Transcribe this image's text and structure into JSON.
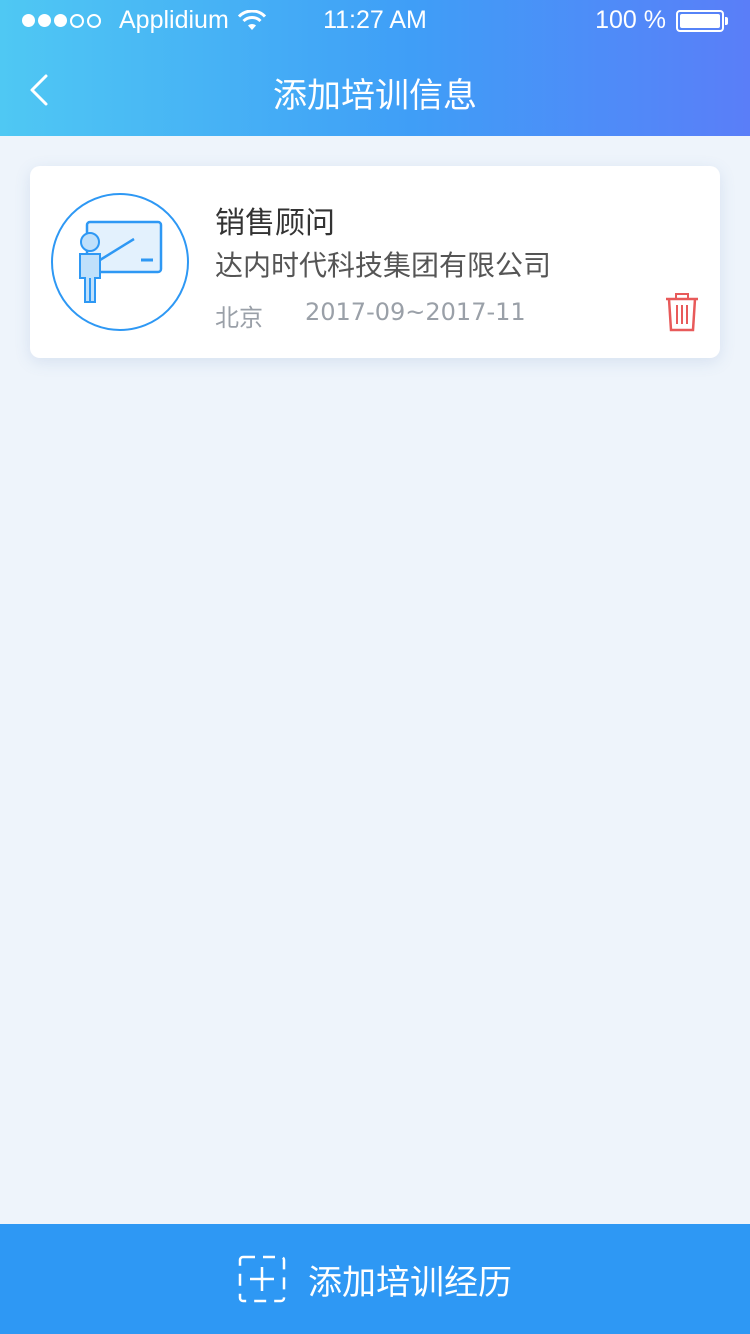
{
  "status_bar": {
    "carrier": "Applidium",
    "time": "11:27 AM",
    "battery": "100 %"
  },
  "header": {
    "title": "添加培训信息"
  },
  "training_record": {
    "job_title": "销售顾问",
    "company": "达内时代科技集团有限公司",
    "city": "北京",
    "period": "2017-09~2017-11"
  },
  "footer": {
    "add_label": "添加培训经历"
  },
  "colors": {
    "accent": "#2e98f4",
    "delete": "#e85a5a"
  }
}
